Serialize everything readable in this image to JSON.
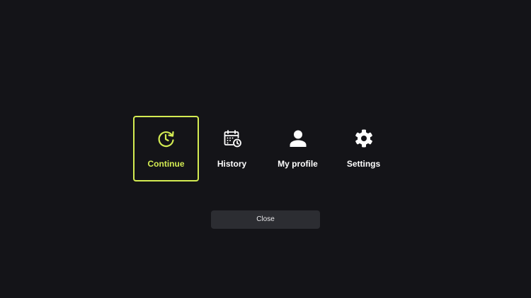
{
  "menu": {
    "items": [
      {
        "label": "Continue",
        "icon": "continue-clock-icon",
        "selected": true
      },
      {
        "label": "History",
        "icon": "calendar-clock-icon",
        "selected": false
      },
      {
        "label": "My profile",
        "icon": "person-icon",
        "selected": false
      },
      {
        "label": "Settings",
        "icon": "gear-icon",
        "selected": false
      }
    ]
  },
  "close_label": "Close",
  "colors": {
    "background": "#141418",
    "accent": "#d4ec52",
    "text": "#ffffff",
    "button_bg": "#2c2d32"
  }
}
